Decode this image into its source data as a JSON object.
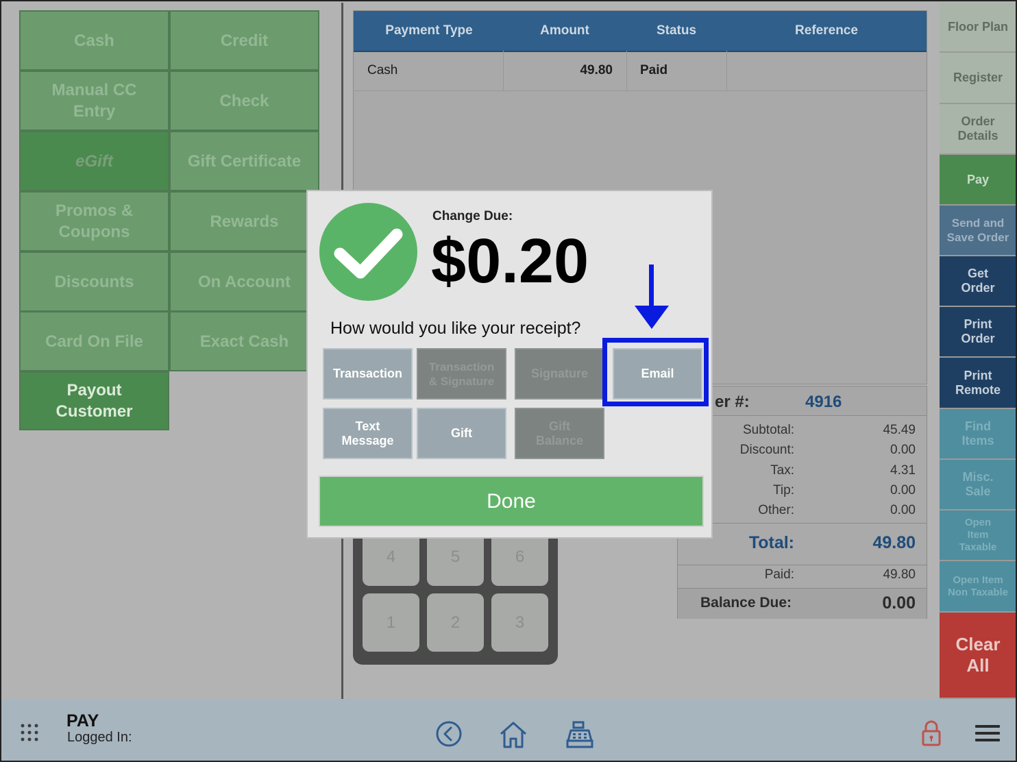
{
  "payment_types": [
    {
      "label": "Cash"
    },
    {
      "label": "Credit"
    },
    {
      "label": "Manual CC Entry"
    },
    {
      "label": "Check"
    },
    {
      "label": "eGift"
    },
    {
      "label": "Gift Certificate"
    },
    {
      "label": "Promos & Coupons"
    },
    {
      "label": "Rewards"
    },
    {
      "label": "Discounts"
    },
    {
      "label": "On Account"
    },
    {
      "label": "Card On File"
    },
    {
      "label": "Exact Cash"
    },
    {
      "label": "Payout Customer"
    }
  ],
  "payments_table": {
    "headers": [
      "Payment Type",
      "Amount",
      "Status",
      "Reference"
    ],
    "rows": [
      {
        "type": "Cash",
        "amount": "49.80",
        "status": "Paid",
        "reference": ""
      }
    ]
  },
  "sidebar": [
    {
      "label": "Floor Plan",
      "color": "#a9b5a9",
      "text_color": "#5f6d60"
    },
    {
      "label": "Register",
      "color": "#a9b5a9",
      "text_color": "#5f6d60"
    },
    {
      "label": "Order Details",
      "color": "#a9b5a9",
      "text_color": "#5f6d60"
    },
    {
      "label": "Pay",
      "color": "#4b8a4f",
      "text_color": "#c9dcc8"
    },
    {
      "label": "Send and Save Order",
      "color": "#4d6f8a",
      "text_color": "#9fb2c2"
    },
    {
      "label": "Get Order",
      "color": "#1f3f62",
      "text_color": "#c6d0da"
    },
    {
      "label": "Print Order",
      "color": "#1f3f62",
      "text_color": "#c6d0da"
    },
    {
      "label": "Print Remote",
      "color": "#1f3f62",
      "text_color": "#c6d0da"
    },
    {
      "label": "Find Items",
      "color": "#4f8e9e",
      "text_color": "#7fb0bd"
    },
    {
      "label": "Misc. Sale",
      "color": "#4f8e9e",
      "text_color": "#7fb0bd"
    },
    {
      "label": "Open Item Taxable",
      "color": "#4f8e9e",
      "text_color": "#7fb0bd"
    },
    {
      "label": "Open Item Non Taxable",
      "color": "#4f8e9e",
      "text_color": "#7fb0bd"
    },
    {
      "label": "Clear All",
      "color": "#b63a35",
      "text_color": "#e9c9c6"
    }
  ],
  "order": {
    "number_label": "er #:",
    "number": "4916",
    "subtotal_label": "Subtotal:",
    "subtotal": "45.49",
    "discount_label": "Discount:",
    "discount": "0.00",
    "tax_label": "Tax:",
    "tax": "4.31",
    "tip_label": "Tip:",
    "tip": "0.00",
    "other_label": "Other:",
    "other": "0.00",
    "total_label": "Total:",
    "total": "49.80",
    "paid_label": "Paid:",
    "paid": "49.80",
    "balance_label": "Balance Due:",
    "balance": "0.00"
  },
  "keypad": {
    "keys": [
      "4",
      "5",
      "6",
      "1",
      "2",
      "3"
    ]
  },
  "dialog": {
    "change_due_label": "Change Due:",
    "change_due_amount": "$0.20",
    "question": "How would you like your receipt?",
    "options": [
      {
        "label": "Transaction",
        "enabled": true
      },
      {
        "label": "Transaction & Signature",
        "enabled": false
      },
      {
        "label": "Signature",
        "enabled": false
      },
      {
        "label": "Email",
        "enabled": true,
        "highlighted": true
      },
      {
        "label": "Text Message",
        "enabled": true
      },
      {
        "label": "Gift",
        "enabled": true
      },
      {
        "label": "Gift Balance",
        "enabled": false
      }
    ],
    "done_label": "Done"
  },
  "footer": {
    "screen_name": "PAY",
    "logged_in_label": "Logged In:",
    "icons": [
      "apps-grid-icon",
      "back-circle-icon",
      "home-icon",
      "cash-register-icon",
      "lock-icon",
      "hamburger-menu-icon"
    ]
  },
  "colors": {
    "highlight": "#0a1be0",
    "done_green": "#62b46a",
    "check_green": "#5ab467"
  }
}
